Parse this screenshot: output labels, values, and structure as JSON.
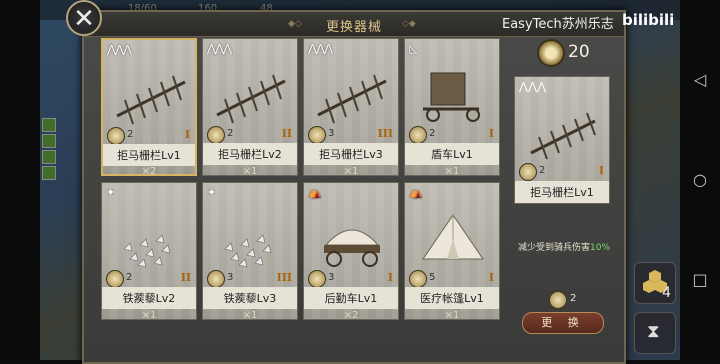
{
  "window": {
    "title": "更换器械"
  },
  "watermark": {
    "brand": "EasyTech苏州乐志",
    "logo": "bilibili"
  },
  "topbar": {
    "values": [
      "18/60",
      "160",
      "48"
    ]
  },
  "currency": {
    "icon": "gear-coin-icon",
    "amount": "20"
  },
  "cards": [
    {
      "name": "拒马栅栏Lv1",
      "cost": "2",
      "tier": "I",
      "count": "×2",
      "icon": "spike-barricade",
      "class_icon": "infantry-class-icon",
      "selected": true
    },
    {
      "name": "拒马栅栏Lv2",
      "cost": "2",
      "tier": "II",
      "count": "×1",
      "icon": "spike-barricade",
      "class_icon": "infantry-class-icon",
      "selected": false
    },
    {
      "name": "拒马栅栏Lv3",
      "cost": "3",
      "tier": "III",
      "count": "×1",
      "icon": "spike-barricade",
      "class_icon": "infantry-class-icon",
      "selected": false
    },
    {
      "name": "盾车Lv1",
      "cost": "2",
      "tier": "I",
      "count": "×1",
      "icon": "shield-cart",
      "class_icon": "archer-class-icon",
      "selected": false
    },
    {
      "name": "铁蒺藜Lv2",
      "cost": "2",
      "tier": "II",
      "count": "×1",
      "icon": "caltrops",
      "class_icon": "cavalry-class-icon",
      "selected": false
    },
    {
      "name": "铁蒺藜Lv3",
      "cost": "3",
      "tier": "III",
      "count": "×1",
      "icon": "caltrops",
      "class_icon": "cavalry-class-icon",
      "selected": false
    },
    {
      "name": "后勤车Lv1",
      "cost": "3",
      "tier": "I",
      "count": "×2",
      "icon": "supply-wagon",
      "class_icon": "tent-class-icon",
      "selected": false
    },
    {
      "name": "医疗帐篷Lv1",
      "cost": "5",
      "tier": "I",
      "count": "×1",
      "icon": "medical-tent",
      "class_icon": "tent-class-icon",
      "selected": false
    }
  ],
  "detail": {
    "name": "拒马栅栏Lv1",
    "cost": "2",
    "tier": "I",
    "effect_text": "减少受到骑兵伤害",
    "effect_value": "10%",
    "swap_cost": "2",
    "swap_label": "更 换"
  },
  "side_buttons": {
    "top": "4"
  },
  "colors": {
    "accent": "#d6b463",
    "positive": "#7cd86a",
    "button": "#6a3526"
  }
}
